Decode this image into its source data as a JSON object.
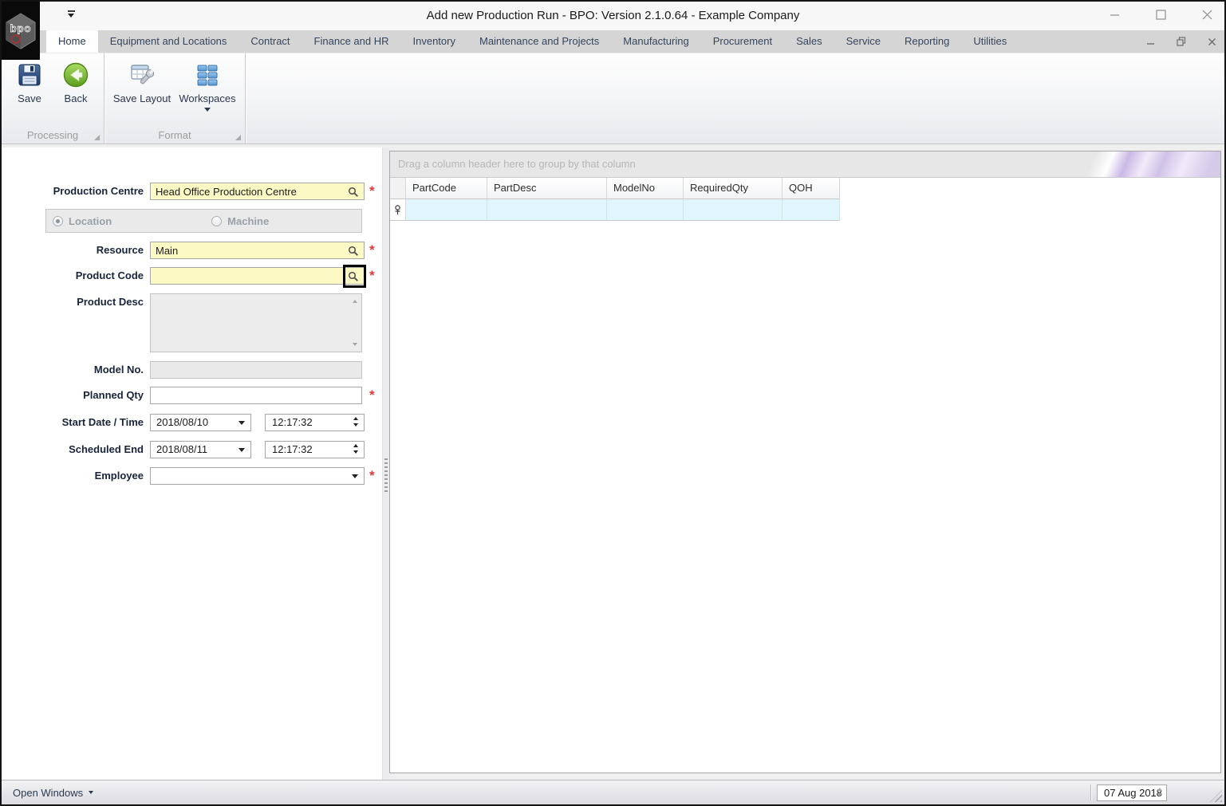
{
  "window": {
    "title": "Add new Production Run - BPO: Version 2.1.0.64 - Example Company",
    "logo_text": "bpo"
  },
  "ribbon": {
    "tabs": [
      {
        "label": "Home",
        "selected": true
      },
      {
        "label": "Equipment and Locations",
        "selected": false
      },
      {
        "label": "Contract",
        "selected": false
      },
      {
        "label": "Finance and HR",
        "selected": false
      },
      {
        "label": "Inventory",
        "selected": false
      },
      {
        "label": "Maintenance and Projects",
        "selected": false
      },
      {
        "label": "Manufacturing",
        "selected": false
      },
      {
        "label": "Procurement",
        "selected": false
      },
      {
        "label": "Sales",
        "selected": false
      },
      {
        "label": "Service",
        "selected": false
      },
      {
        "label": "Reporting",
        "selected": false
      },
      {
        "label": "Utilities",
        "selected": false
      }
    ],
    "buttons": {
      "save": "Save",
      "back": "Back",
      "save_layout": "Save Layout",
      "workspaces": "Workspaces"
    },
    "groups": {
      "processing": "Processing",
      "format": "Format"
    }
  },
  "form": {
    "production_centre": {
      "label": "Production Centre",
      "value": "Head Office Production Centre",
      "required": "*"
    },
    "location_machine": {
      "location": "Location",
      "machine": "Machine",
      "selected": "Location"
    },
    "resource": {
      "label": "Resource",
      "value": "Main",
      "required": "*"
    },
    "product_code": {
      "label": "Product Code",
      "value": "",
      "required": "*"
    },
    "product_desc": {
      "label": "Product Desc",
      "value": ""
    },
    "model_no": {
      "label": "Model No.",
      "value": ""
    },
    "planned_qty": {
      "label": "Planned Qty",
      "value": "",
      "required": "*"
    },
    "start_date_time": {
      "label": "Start Date / Time",
      "date": "2018/08/10",
      "time": "12:17:32"
    },
    "scheduled_end": {
      "label": "Scheduled End",
      "date": "2018/08/11",
      "time": "12:17:32"
    },
    "employee": {
      "label": "Employee",
      "value": "",
      "required": "*"
    }
  },
  "grid": {
    "group_by_hint": "Drag a column header here to group by that column",
    "columns": [
      "PartCode",
      "PartDesc",
      "ModelNo",
      "RequiredQty",
      "QOH"
    ],
    "rows": []
  },
  "status_bar": {
    "open_windows": "Open Windows",
    "date": "07 Aug 2018"
  },
  "colors": {
    "required_field_bg": "#FCF9C5",
    "required_marker": "#E03A3A",
    "filter_row_bg": "#E1F6FC",
    "back_button_green": "#7FBF3F",
    "save_icon_blue": "#2C4A77",
    "workspaces_tile_blue": "#5C9FD6",
    "groupby_swoosh": "#C5B0E4"
  }
}
